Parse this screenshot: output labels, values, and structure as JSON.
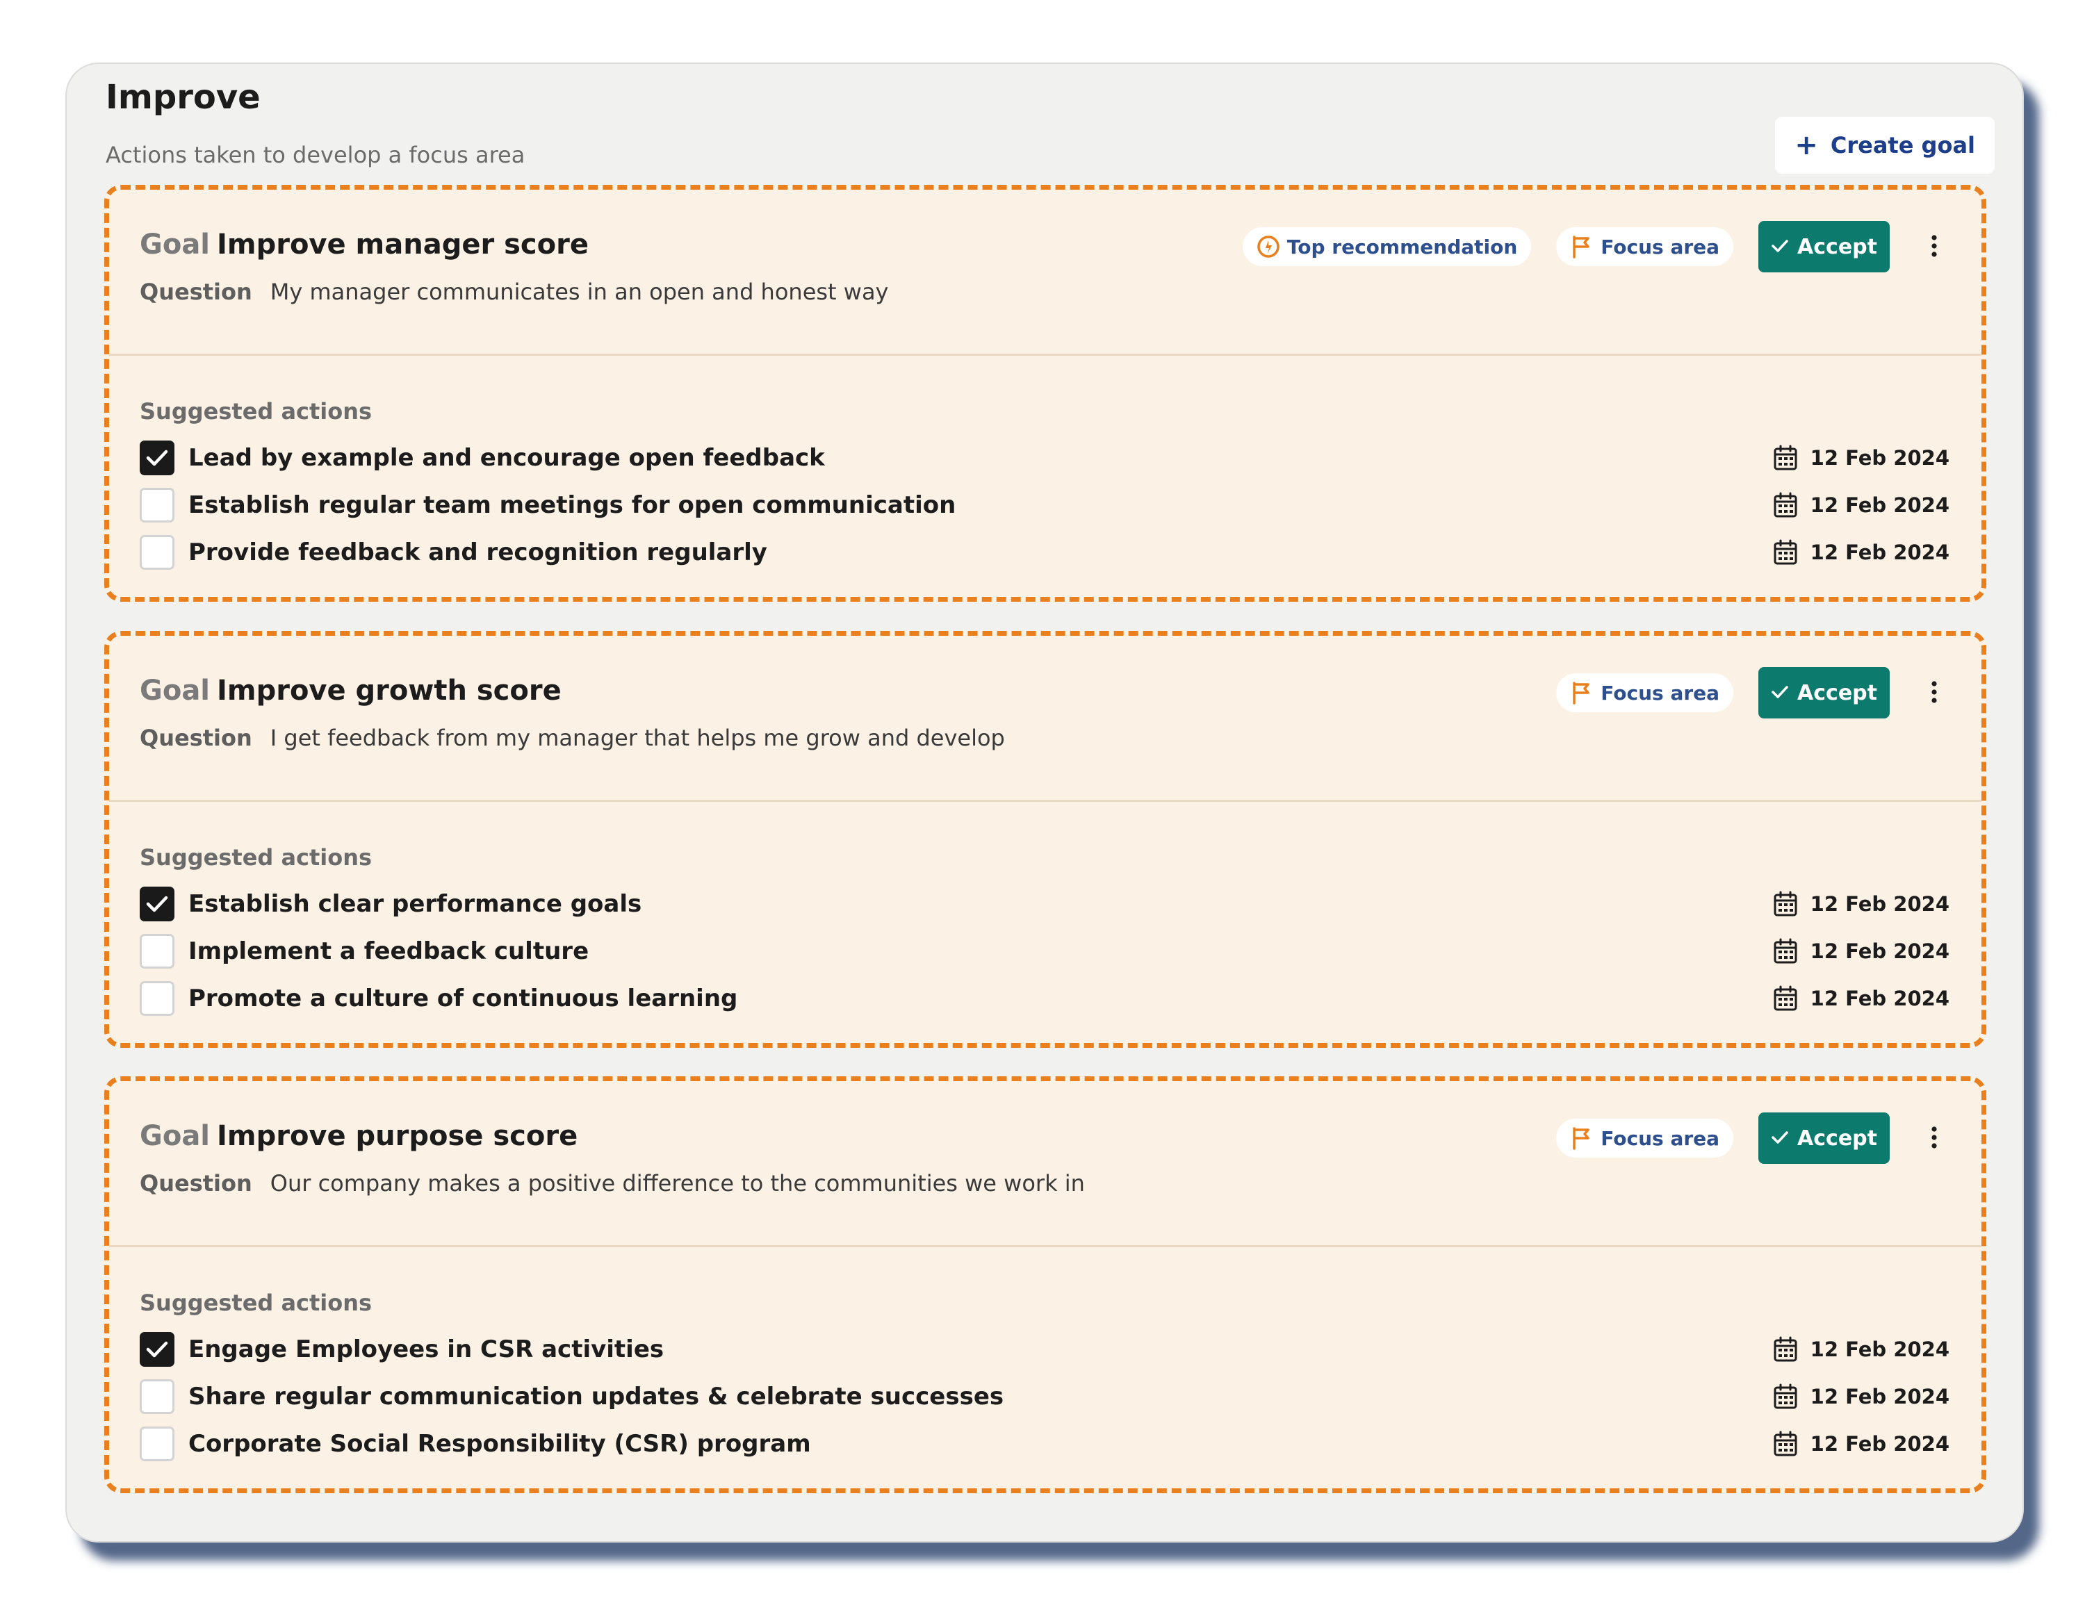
{
  "section": {
    "title": "Improve",
    "subtitle": "Actions taken to develop a focus area",
    "create_goal_label": "Create goal",
    "create_goal_icon": "plus-icon"
  },
  "labels": {
    "goal_prefix": "Goal",
    "question_prefix": "Question",
    "suggested_actions": "Suggested actions",
    "top_recommendation": "Top recommendation",
    "focus_area": "Focus area",
    "accept": "Accept"
  },
  "colors": {
    "card_border": "#e9801d",
    "card_background": "#fbf1e4",
    "accept_button": "#0c7a6d",
    "create_goal_text": "#1d3f8b",
    "flag_icon": "#e9801d"
  },
  "goals": [
    {
      "title": "Improve manager score",
      "question": "My manager communicates in an open and honest way",
      "top_recommendation": true,
      "actions": [
        {
          "label": "Lead by example and encourage open feedback",
          "checked": true,
          "date": "12 Feb 2024"
        },
        {
          "label": "Establish regular team meetings for open communication",
          "checked": false,
          "date": "12 Feb 2024"
        },
        {
          "label": "Provide feedback and recognition regularly",
          "checked": false,
          "date": "12 Feb 2024"
        }
      ]
    },
    {
      "title": "Improve growth score",
      "question": "I get feedback from my manager that helps me grow and develop",
      "top_recommendation": false,
      "actions": [
        {
          "label": "Establish clear performance goals",
          "checked": true,
          "date": "12 Feb 2024"
        },
        {
          "label": "Implement a feedback culture",
          "checked": false,
          "date": "12 Feb 2024"
        },
        {
          "label": "Promote a culture of continuous learning",
          "checked": false,
          "date": "12 Feb 2024"
        }
      ]
    },
    {
      "title": "Improve purpose score",
      "question": "Our company makes a positive difference to the communities we work in",
      "top_recommendation": false,
      "actions": [
        {
          "label": "Engage Employees in CSR activities",
          "checked": true,
          "date": "12 Feb 2024"
        },
        {
          "label": "Share regular communication updates & celebrate successes",
          "checked": false,
          "date": "12 Feb 2024"
        },
        {
          "label": "Corporate Social Responsibility (CSR) program",
          "checked": false,
          "date": "12 Feb 2024"
        }
      ]
    }
  ]
}
